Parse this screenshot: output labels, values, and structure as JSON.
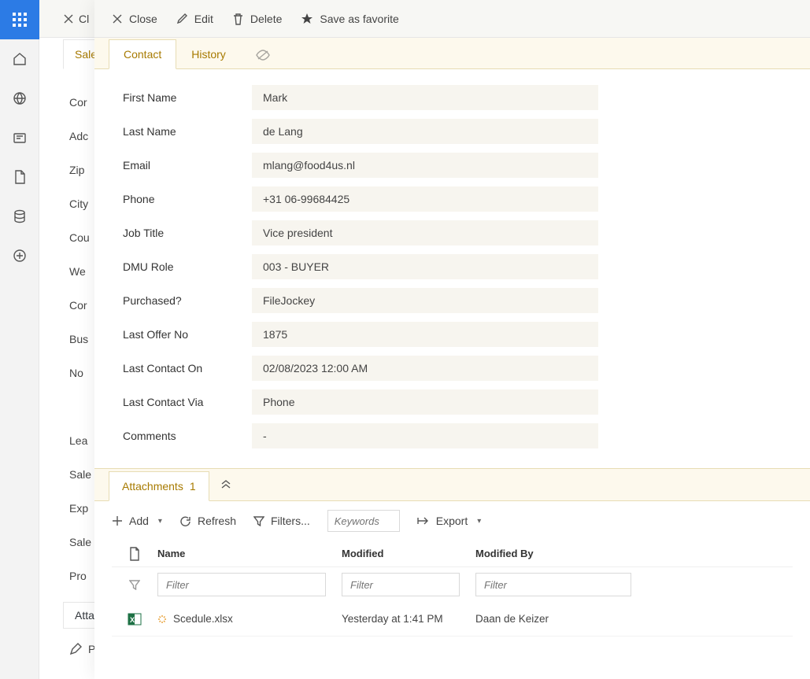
{
  "leftRail": {
    "items": [
      "apps",
      "home",
      "globe",
      "news",
      "file",
      "db",
      "add"
    ]
  },
  "bg": {
    "closeFragment": "Cl",
    "tab": "Sale",
    "fields": [
      "Cor",
      "Adc",
      "Zip",
      "City",
      "Cou",
      "We",
      "Cor",
      "Bus",
      "No",
      "",
      "Lea",
      "Sale",
      "Exp",
      "Sale",
      "Pro"
    ],
    "bottomTab": "Atta",
    "printFragment": "P"
  },
  "toolbar": {
    "close": "Close",
    "edit": "Edit",
    "delete": "Delete",
    "favorite": "Save as favorite"
  },
  "tabs": {
    "contact": "Contact",
    "history": "History"
  },
  "form": [
    {
      "label": "First Name",
      "value": "Mark"
    },
    {
      "label": "Last Name",
      "value": "de Lang"
    },
    {
      "label": "Email",
      "value": "mlang@food4us.nl"
    },
    {
      "label": "Phone",
      "value": "+31 06-99684425"
    },
    {
      "label": "Job Title",
      "value": "Vice president"
    },
    {
      "label": "DMU Role",
      "value": "003 - BUYER"
    },
    {
      "label": "Purchased?",
      "value": "FileJockey"
    },
    {
      "label": "Last Offer No",
      "value": "1875"
    },
    {
      "label": "Last Contact On",
      "value": "02/08/2023 12:00 AM"
    },
    {
      "label": "Last Contact Via",
      "value": "Phone"
    },
    {
      "label": "Comments",
      "value": "-"
    }
  ],
  "attachments": {
    "tabLabel": "Attachments",
    "count": "1",
    "toolbar": {
      "add": "Add",
      "refresh": "Refresh",
      "filters": "Filters...",
      "keywordsPlaceholder": "Keywords",
      "export": "Export"
    },
    "columns": {
      "name": "Name",
      "modified": "Modified",
      "modifiedBy": "Modified By"
    },
    "filterPlaceholder": "Filter",
    "rows": [
      {
        "file": "Scedule.xlsx",
        "modified": "Yesterday at 1:41 PM",
        "by": "Daan de Keizer"
      }
    ]
  }
}
